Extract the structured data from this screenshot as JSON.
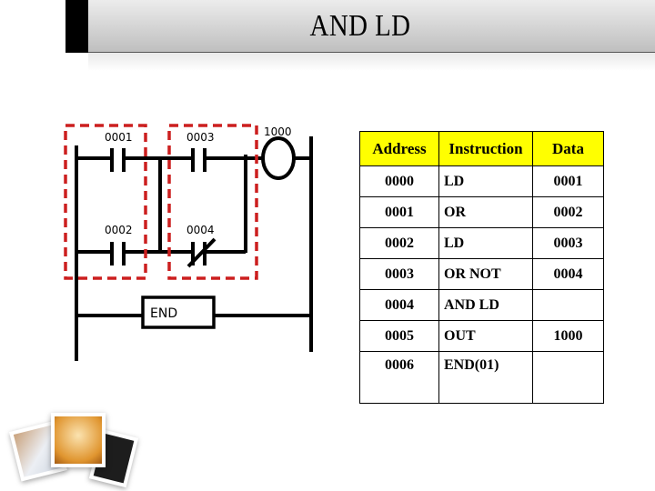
{
  "title": "AND LD",
  "ladder": {
    "contacts": [
      {
        "id": "0001",
        "type": "normally-open"
      },
      {
        "id": "0002",
        "type": "normally-open"
      },
      {
        "id": "0003",
        "type": "normally-open"
      },
      {
        "id": "0004",
        "type": "normally-closed"
      }
    ],
    "coil": {
      "id": "1000"
    },
    "end_label": "END",
    "highlight_color": "#cc1f1f"
  },
  "table": {
    "header_color": "#ffff00",
    "headers": [
      "Address",
      "Instruction",
      "Data"
    ],
    "rows": [
      {
        "address": "0000",
        "instruction": "LD",
        "data": "0001"
      },
      {
        "address": "0001",
        "instruction": "OR",
        "data": "0002"
      },
      {
        "address": "0002",
        "instruction": "LD",
        "data": "0003"
      },
      {
        "address": "0003",
        "instruction": "OR NOT",
        "data": "0004"
      },
      {
        "address": "0004",
        "instruction": "AND LD",
        "data": ""
      },
      {
        "address": "0005",
        "instruction": "OUT",
        "data": "1000"
      },
      {
        "address": "0006",
        "instruction": "END(01)",
        "data": ""
      }
    ]
  }
}
